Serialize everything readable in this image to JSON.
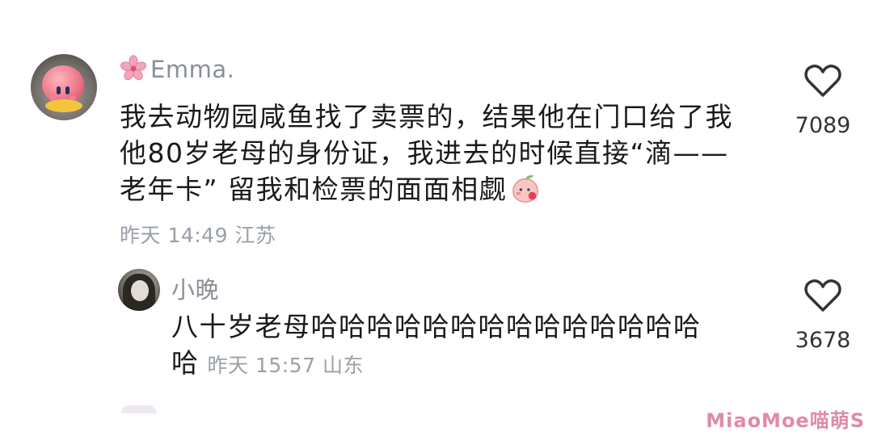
{
  "comments": [
    {
      "username": "Emma.",
      "text_lines": [
        "我去动物园咸鱼找了卖票的，结果他在门口给了我",
        "他80岁老母的身份证，我进去的时候直接“滴——",
        "老年卡” 留我和检票的面面相觑"
      ],
      "meta": "昨天 14:49 江苏",
      "likes": "7089"
    },
    {
      "username": "小晚",
      "text_lines": [
        "八十岁老母哈哈哈哈哈哈哈哈哈哈哈哈哈哈",
        "哈"
      ],
      "meta": "昨天 15:57 山东",
      "likes": "3678"
    }
  ],
  "watermark": "MiaoMoe喵萌S",
  "colors": {
    "accent_text": "#1a1a1a",
    "meta_text": "#9aa0a8",
    "heart_stroke": "#333333"
  },
  "icons": [
    "heart-outline-icon",
    "sakura-flower-icon",
    "peach-emoji-icon"
  ]
}
